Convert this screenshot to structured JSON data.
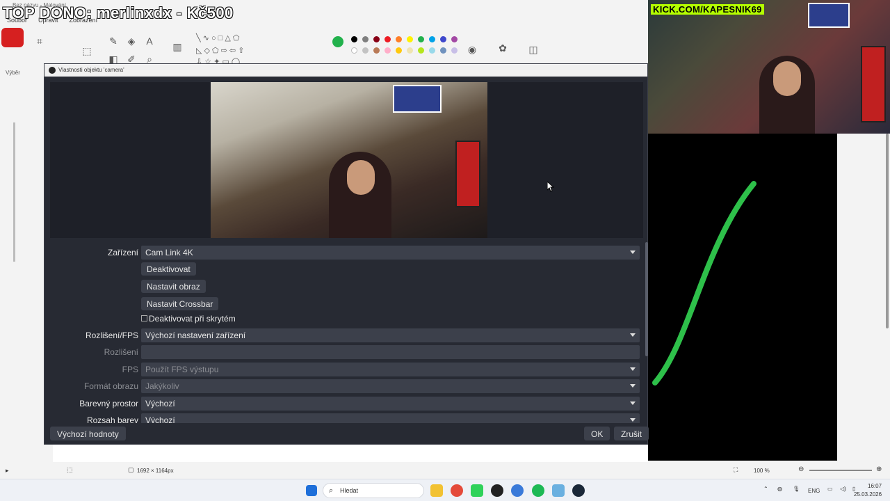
{
  "paint": {
    "window_title": "Bez názvu - Malování",
    "menu": [
      "Soubor",
      "Upravit",
      "Zobrazení"
    ],
    "select_label": "Výběr",
    "colors": [
      "#000000",
      "#7f7f7f",
      "#880015",
      "#ed1c24",
      "#ff7f27",
      "#fff200",
      "#22b14c",
      "#00a2e8",
      "#3f48cc",
      "#a349a4",
      "#ffffff",
      "#c3c3c3",
      "#b97a57",
      "#ffaec9",
      "#ffc90e",
      "#efe4b0",
      "#b5e61d",
      "#99d9ea",
      "#7092be",
      "#c8bfe7"
    ],
    "active_color": "#22b14c",
    "canvas_size": "1692 × 1164px",
    "zoom": "100 %"
  },
  "overlay": {
    "donation_text": "TOP DONO: merlinxdx - Kč500",
    "kick_text": "KICK.COM/KAPESNIK69"
  },
  "dialog": {
    "title": "Vlastnosti objektu 'camera'",
    "fields": {
      "device_label": "Zařízení",
      "device_value": "Cam Link 4K",
      "deactivate_button": "Deaktivovat",
      "configure_video_button": "Nastavit obraz",
      "configure_crossbar_button": "Nastavit Crossbar",
      "deactivate_hidden_label": "Deaktivovat při skrytém",
      "resolution_fps_label": "Rozlišení/FPS",
      "resolution_fps_value": "Výchozí nastavení zařízení",
      "resolution_label": "Rozlišení",
      "resolution_value": "",
      "fps_label": "FPS",
      "fps_value": "Použít FPS výstupu",
      "video_format_label": "Formát obrazu",
      "video_format_value": "Jakýkoliv",
      "color_space_label": "Barevný prostor",
      "color_space_value": "Výchozí",
      "color_range_label": "Rozsah barev",
      "color_range_value": "Výchozí"
    },
    "defaults_button": "Výchozí hodnoty",
    "ok_button": "OK",
    "cancel_button": "Zrušit"
  },
  "taskbar": {
    "search_placeholder": "Hledat",
    "language": "ENG",
    "time": "16:07",
    "date": "25.03.2026"
  }
}
